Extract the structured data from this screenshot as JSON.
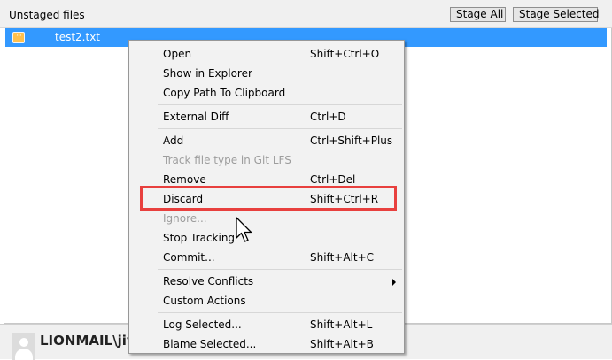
{
  "header": {
    "title": "Unstaged files",
    "stage_all_label": "Stage All",
    "stage_selected_label": "Stage Selected"
  },
  "files": [
    {
      "name": "test2.txt",
      "icon": "modified-file-icon",
      "icon_glyph": "···"
    }
  ],
  "context_menu": {
    "items": [
      {
        "label": "Open",
        "shortcut": "Shift+Ctrl+O",
        "enabled": true
      },
      {
        "label": "Show in Explorer",
        "shortcut": "",
        "enabled": true
      },
      {
        "label": "Copy Path To Clipboard",
        "shortcut": "",
        "enabled": true
      },
      {
        "label": "External Diff",
        "shortcut": "Ctrl+D",
        "enabled": true
      },
      {
        "label": "Add",
        "shortcut": "Ctrl+Shift+Plus",
        "enabled": true
      },
      {
        "label": "Track file type in Git LFS",
        "shortcut": "",
        "enabled": false
      },
      {
        "label": "Remove",
        "shortcut": "Ctrl+Del",
        "enabled": true
      },
      {
        "label": "Discard",
        "shortcut": "Shift+Ctrl+R",
        "enabled": true,
        "highlighted": true
      },
      {
        "label": "Ignore...",
        "shortcut": "",
        "enabled": false
      },
      {
        "label": "Stop Tracking",
        "shortcut": "",
        "enabled": true
      },
      {
        "label": "Commit...",
        "shortcut": "Shift+Alt+C",
        "enabled": true
      },
      {
        "label": "Resolve Conflicts",
        "shortcut": "",
        "enabled": true,
        "submenu": true
      },
      {
        "label": "Custom Actions",
        "shortcut": "",
        "enabled": true
      },
      {
        "label": "Log Selected...",
        "shortcut": "Shift+Alt+L",
        "enabled": true
      },
      {
        "label": "Blame Selected...",
        "shortcut": "Shift+Alt+B",
        "enabled": true
      }
    ]
  },
  "footer": {
    "user_name": "LIONMAIL\\jive"
  },
  "colors": {
    "selection": "#3399ff",
    "file_icon": "#ffc04d",
    "highlight_box": "#e8403e",
    "menu_background": "#f2f2f2",
    "disabled_text": "#9d9d9d"
  }
}
